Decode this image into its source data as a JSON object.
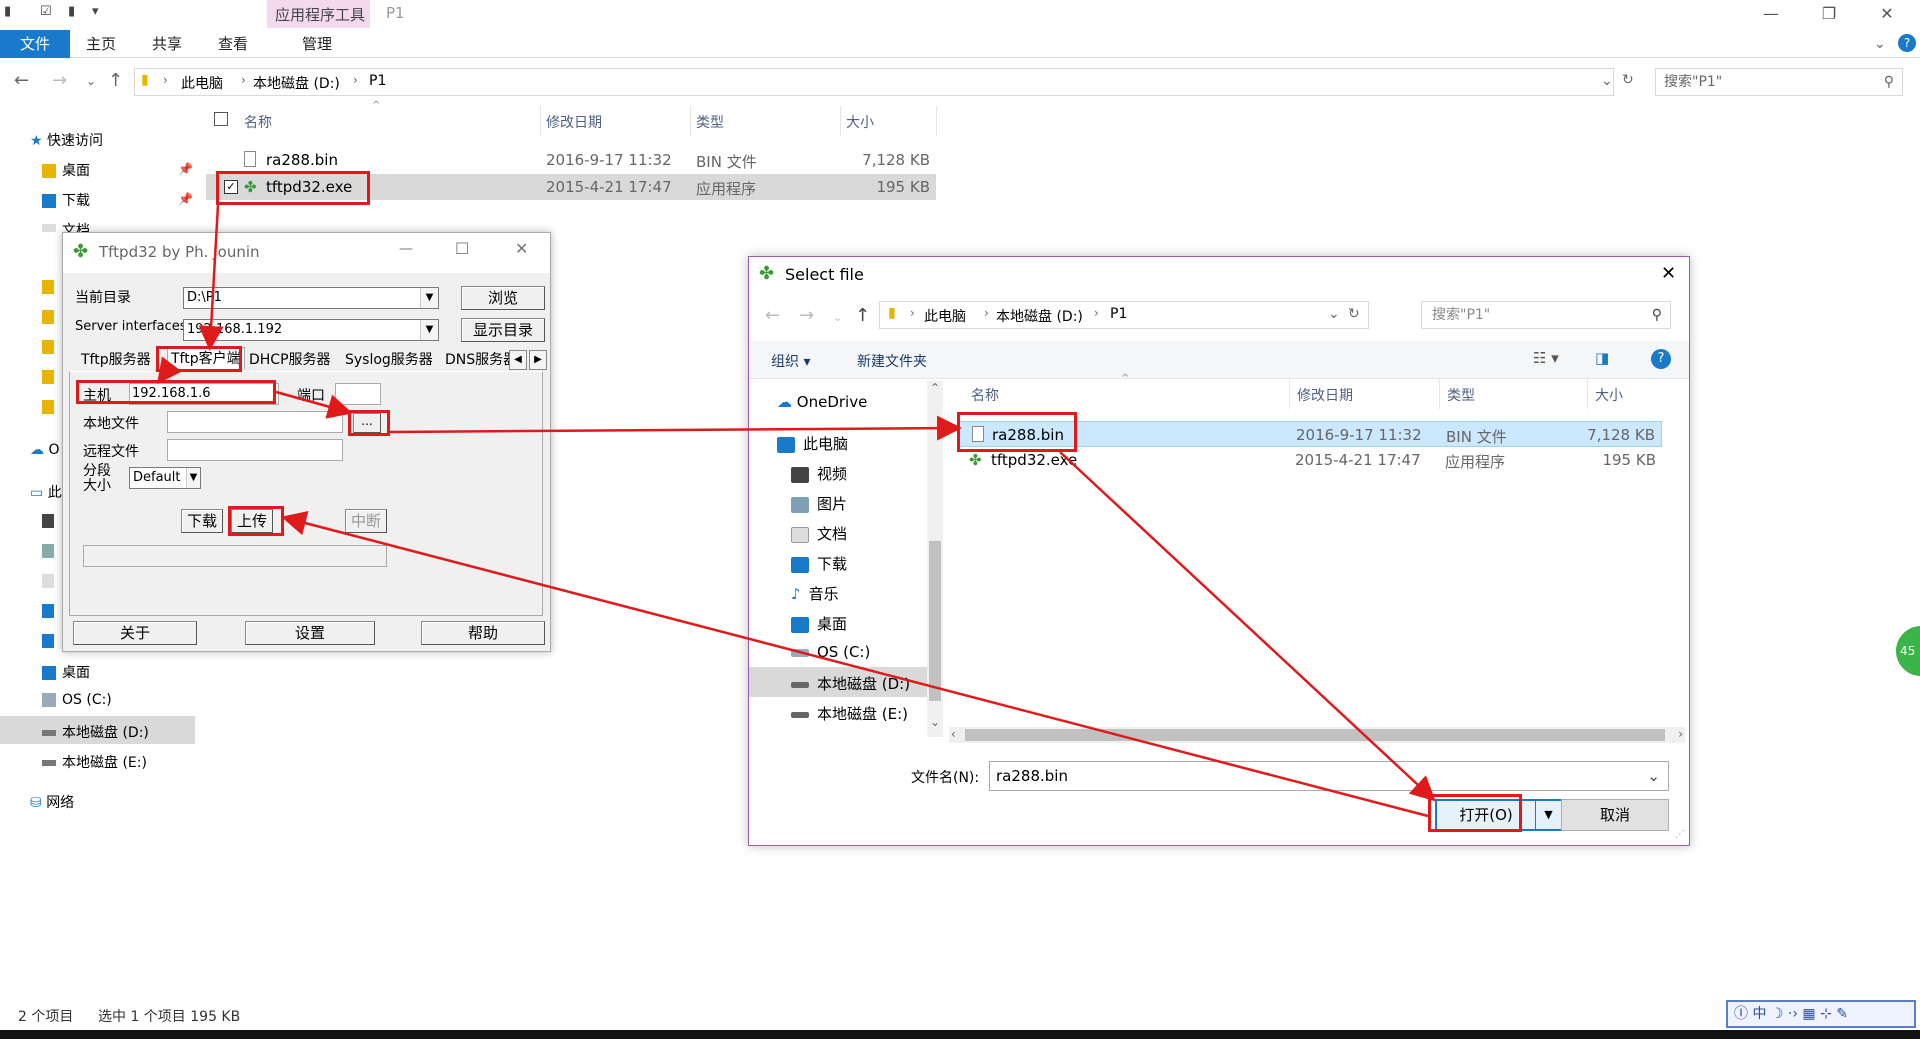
{
  "explorer": {
    "app_tools_label": "应用程序工具",
    "window_title": "P1",
    "tabs": [
      "文件",
      "主页",
      "共享",
      "查看",
      "管理"
    ],
    "breadcrumb": [
      "此电脑",
      "本地磁盘 (D:)",
      "P1"
    ],
    "search_placeholder": "搜索\"P1\"",
    "nav": {
      "quick_access": "快速访问",
      "quick_items": [
        "桌面",
        "下载",
        "文档"
      ],
      "desktop": "桌面",
      "os_c": "OS (C:)",
      "local_d": "本地磁盘 (D:)",
      "local_e": "本地磁盘 (E:)",
      "network": "网络",
      "onedrive_partial": "O",
      "thispc_partial": "此"
    },
    "columns": {
      "name": "名称",
      "modified": "修改日期",
      "type": "类型",
      "size": "大小"
    },
    "files": [
      {
        "name": "ra288.bin",
        "modified": "2016-9-17 11:32",
        "type": "BIN 文件",
        "size": "7,128 KB"
      },
      {
        "name": "tftpd32.exe",
        "modified": "2015-4-21 17:47",
        "type": "应用程序",
        "size": "195 KB"
      }
    ],
    "status": {
      "count": "2 个项目",
      "selected": "选中 1 个项目  195 KB"
    }
  },
  "tftpd": {
    "title": "Tftpd32 by Ph. Jounin",
    "current_dir_label": "当前目录",
    "current_dir_value": "D:\\P1",
    "browse_button": "浏览",
    "server_if_label": "Server interfaces",
    "server_if_value": "192.168.1.192",
    "show_dir_button": "显示目录",
    "tabs": [
      "Tftp服务器",
      "Tftp客户端",
      "DHCP服务器",
      "Syslog服务器",
      "DNS服务器"
    ],
    "host_label": "主机",
    "host_value": "192.168.1.6",
    "port_label": "端口",
    "local_file_label": "本地文件",
    "browse_small": "...",
    "remote_file_label": "远程文件",
    "block_label_1": "分段",
    "block_label_2": "大小",
    "block_value": "Default",
    "download_button": "下载",
    "upload_button": "上传",
    "break_button": "中断",
    "about_button": "关于",
    "settings_button": "设置",
    "help_button": "帮助"
  },
  "select_file": {
    "title": "Select file",
    "breadcrumb": [
      "此电脑",
      "本地磁盘 (D:)",
      "P1"
    ],
    "search_placeholder": "搜索\"P1\"",
    "organize": "组织 ▾",
    "new_folder": "新建文件夹",
    "nav": [
      "OneDrive",
      "此电脑",
      "视频",
      "图片",
      "文档",
      "下载",
      "音乐",
      "桌面",
      "OS (C:)",
      "本地磁盘 (D:)",
      "本地磁盘 (E:)"
    ],
    "columns": {
      "name": "名称",
      "modified": "修改日期",
      "type": "类型",
      "size": "大小"
    },
    "files": [
      {
        "name": "ra288.bin",
        "modified": "2016-9-17 11:32",
        "type": "BIN 文件",
        "size": "7,128 KB"
      },
      {
        "name": "tftpd32.exe",
        "modified": "2015-4-21 17:47",
        "type": "应用程序",
        "size": "195 KB"
      }
    ],
    "filename_label": "文件名(N):",
    "filename_value": "ra288.bin",
    "open_button": "打开(O)",
    "cancel_button": "取消"
  },
  "colors": {
    "accent": "#1979ca",
    "annotation": "#e01a1a",
    "selection": "#cce8ff"
  }
}
